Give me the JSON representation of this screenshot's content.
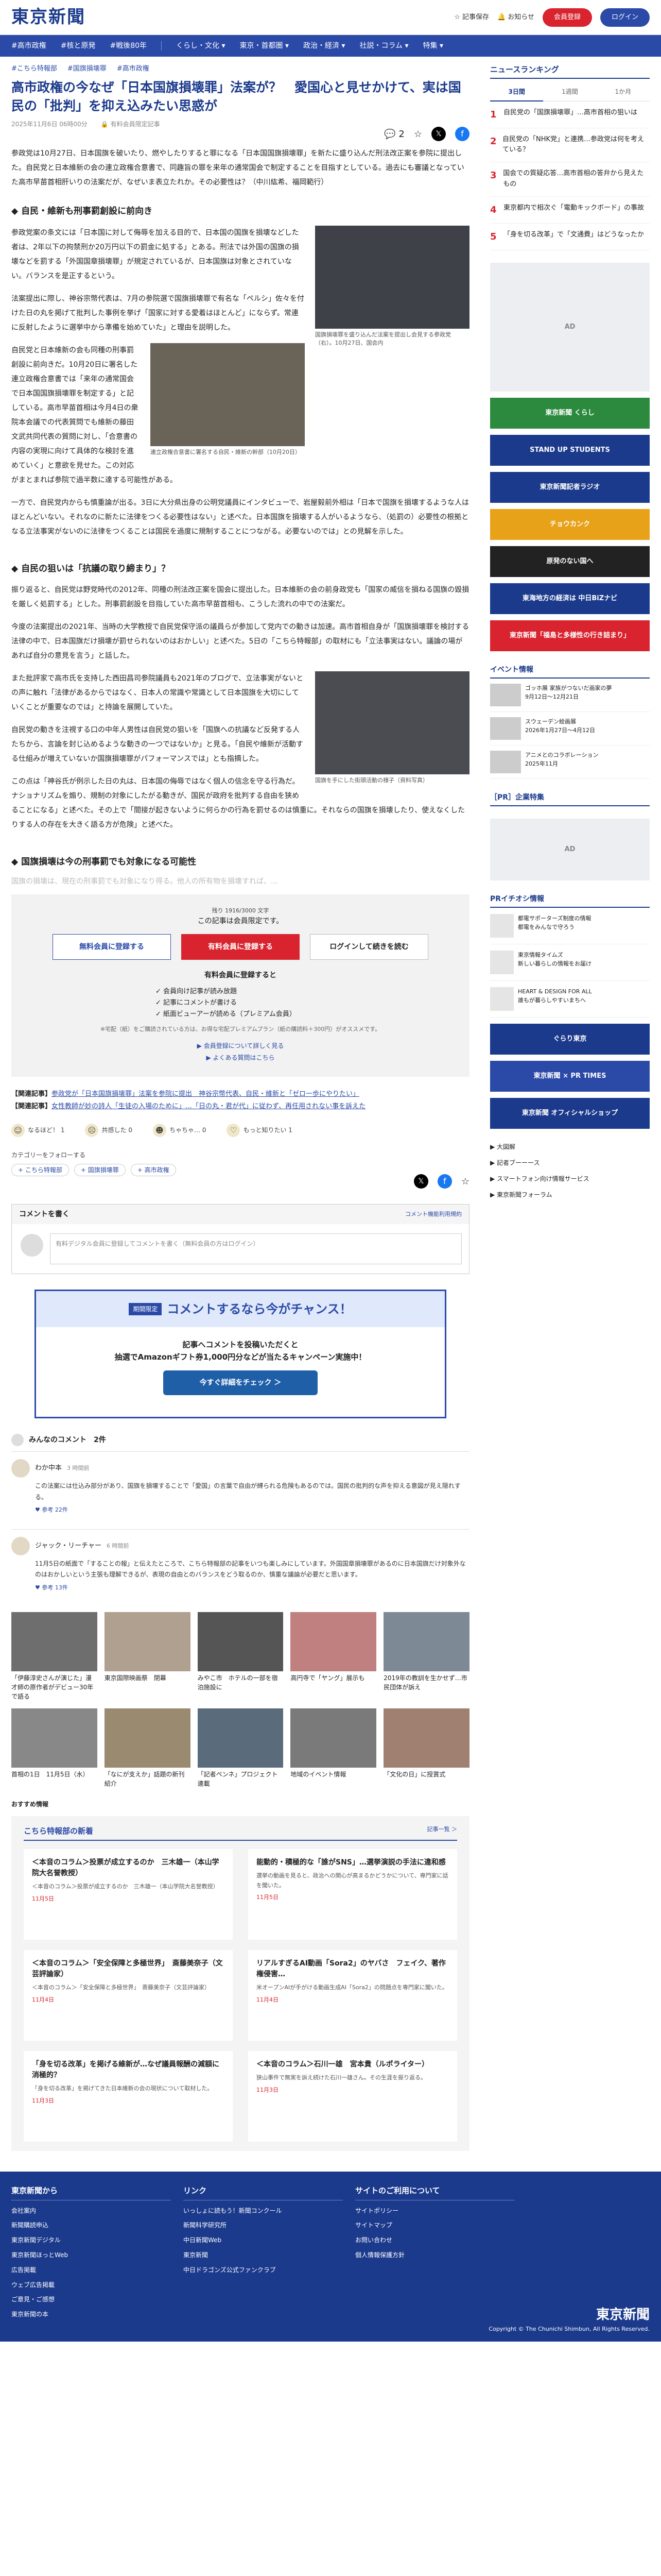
{
  "header": {
    "logo": "東京新聞",
    "bookmark": "記事保存",
    "notice": "お知らせ",
    "register": "会員登録",
    "login": "ログイン"
  },
  "nav": [
    "#高市政権",
    "#核と原発",
    "#戦後80年",
    "くらし・文化 ▾",
    "東京・首都圏 ▾",
    "政治・経済 ▾",
    "社説・コラム ▾",
    "特集 ▾"
  ],
  "article": {
    "crumbs": [
      "#こちら特報部",
      "#国旗損壊罪",
      "#高市政権"
    ],
    "title": "高市政権の今なぜ「日本国旗損壊罪」法案が？　愛国心と見せかけて、実は国民の「批判」を抑え込みたい思惑が",
    "date": "2025年11月6日 06時00分",
    "member": "有料会員限定記事",
    "comments": "2",
    "lead": "参政党は10月27日、日本国旗を破いたり、燃やしたりすると罪になる「日本国国旗損壊罪」を新たに盛り込んだ刑法改正案を参院に提出した。自民党と日本維新の会の連立政権合意書で、同趣旨の罪を来年の通常国会で制定することを目指すとしている。過去にも審議となっていた高市早苗首相肝いりの法案だが、なぜいま表立たれか。その必要性は？（中川紘希、福岡範行）",
    "h1": "自民・維新も刑事罰創設に前向き",
    "p1": "参政党案の条文には「日本国に対して侮辱を加える目的で、日本国の国旗を損壊などした者は、2年以下の拘禁刑か20万円以下の罰金に処する」とある。刑法では外国の国旗の損壊などを罰する「外国国章損壊罪」が規定されているが、日本国旗は対象とされていない。バランスを是正するという。",
    "p2": "法案提出に際し、神谷宗幣代表は、7月の参院選で国旗損壊罪で有名な「ペルシ」佐々を付けた日の丸を掲げて批判した事例を挙げ「国家に対する愛着はほとんど」にならず。常連に反射したように選挙中から準備を始めていた」と理由を説明した。",
    "p3": "自民党と日本維新の会も同種の刑事罰創設に前向きだ。10月20日に署名した連立政権合意書では「来年の通常国会で日本国国旗損壊罪を制定する」と記している。高市早苗首相は今月4日の衆院本会議での代表質問でも維新の藤田文武共同代表の質問に対し、「合意書の内容の実現に向けて具体的な検討を進めていく」と意欲を見せた。この対応がまとまれば参院で過半数に達する可能性がある。",
    "p4": "一方で、自民党内からも慎重論が出る。3日に大分県出身の公明党議員にインタビューで、岩屋毅前外相は「日本で国旗を損壊するような人はほとんどいない。それなのに新たに法律をつくる必要性はない」と述べた。日本国旗を損壊する人がいるようなら、（処罰の）必要性の根拠となる立法事実がないのに法律をつくることは国民を過度に規制することにつながる。必要ないのでは」との見解を示した。",
    "h2": "自民の狙いは「抗議の取り締まり」？",
    "p5": "振り返ると、自民党は野党時代の2012年、同種の刑法改正案を国会に提出した。日本維新の会の前身政党も「国家の威信を損ねる国旗の毀損を厳しく処罰する」とした。刑事罰創設を目指していた高市早苗首相も、こうした流れの中での法案だ。",
    "p6": "今度の法案提出の2021年、当時の大学教授で自民党保守派の議員らが参加して党内での動きは加速。高市首相自身が「国旗損壊罪を検討する法律の中で、日本国旗だけ損壊が罰せられないのはおかしい」と述べた。5日の「こちら特報部」の取材にも「立法事実はない。議論の場があれば自分の意見を言う」と話した。",
    "p7": "また批評家で高市氏を支持した西田昌司参院議員も2021年のブログで、立法事実がないとの声に触れ「法律があるからではなく、日本人の常識や常識として日本国旗を大切にしていくことが重要なのでは」と持論を展開していた。",
    "p8": "自民党の動きを注視する口の中年人男性は自民党の狙いを「国旗への抗議など反発する人たちから、言論を封じ込めるような動きの一つではないか」と見る。「自民や維新が活動する仕組みが増えていないか国旗損壊罪がパフォーマンスでは」とも指摘した。",
    "p9": "この点は「神谷氏が例示した日の丸は、日本国の侮辱ではなく個人の信念を守る行為だ。ナショナリズムを煽り、規制の対象にしたがる動きが、国民が政府を批判する自由を狭めることになる」と述べた。その上で「間接が起きないように何らかの行為を罰せるのは慎重に。それならの国旗を損壊したり、使えなくしたりする人の存在を大きく語る方が危険」と述べた。",
    "h3": "国旗損壊は今の刑事罰でも対象になる可能性",
    "blur": "国旗の損壊は、現在の刑事罰でも対象になり得る。他人の所有物を損壊すれば、...",
    "figs": [
      {
        "cap": "国旗損壊罪を盛り込んだ法案を提出し会見する参政党（右）。10月27日、国会内"
      },
      {
        "cap": "連立政権合意書に署名する自民・維新の幹部（10月20日）"
      },
      {
        "cap": "国旗を手にした街頭活動の様子（資料写真）"
      }
    ]
  },
  "paywall": {
    "limit": "残り 1916/3000 文字",
    "t1": "この記事は会員限定です。",
    "free": "無料会員に登録する",
    "paid": "有料会員に登録する",
    "cont": "ログインして続きを読む",
    "t2": "有料会員に登録すると",
    "benefits": [
      "✓ 会員向け記事が読み放題",
      "✓ 記事にコメントが書ける",
      "✓ 紙面ビューアーが読める（プレミアム会員）"
    ],
    "fine": "※宅配（紙）をご購読されている方は、お得な宅配プレミアムプラン（紙の購読料＋300円）がオススメです。",
    "link1": "▶ 会員登録について詳しく見る",
    "link2": "▶ よくある質問はこちら"
  },
  "related": [
    {
      "label": "【関連記事】",
      "text": "参政党が「日本国旗損壊罪」法案を参院に提出　神谷宗幣代表、自民・維新と「ゼロ一歩にやりたい」"
    },
    {
      "label": "【関連記事】",
      "text": "女性教師が妙の詩人「生徒の入場のために」…「日の丸・君が代」に従わず、再任用されない事を訴えた"
    }
  ],
  "reactions": [
    {
      "icon": "☺",
      "label": "なるほど！",
      "count": "1"
    },
    {
      "icon": "☹",
      "label": "共感した",
      "count": "0"
    },
    {
      "icon": "☻",
      "label": "ちゃちゃ…",
      "count": "0"
    },
    {
      "icon": "♡",
      "label": "もっと知りたい",
      "count": "1"
    }
  ],
  "follow": {
    "label": "カテゴリーをフォローする",
    "tags": [
      "+ こちら特報部",
      "+ 国旗損壊罪",
      "+ 高市政権"
    ]
  },
  "commentbox": {
    "title": "コメントを書く",
    "note": "コメント機能利用規約",
    "text": "有料デジタル会員に登録してコメントを書く（無料会員の方はログイン）"
  },
  "campaign": {
    "badge": "期間限定",
    "title": "コメントするなら今がチャンス！",
    "body": "記事へコメントを投稿いただくと\n抽選でAmazonギフト券1,000円分などが当たるキャンペーン実施中！",
    "btn": "今すぐ詳細をチェック ＞"
  },
  "comments": {
    "title": "みんなのコメント　2件",
    "items": [
      {
        "name": "わか中本",
        "time": "3 時間前",
        "body": "この法案には仕込み部分があり、国旗を損壊することで「愛国」の言葉で自由が縛られる危険もあるのでは。国民の批判的な声を抑える意図が見え隠れする。",
        "ft": "♥ 参考 22件"
      },
      {
        "name": "ジャック・リーチャー",
        "time": "6 時間前",
        "body": "11月5日の紙面で「することの報」と伝えたところで、こちら特報部の記事をいつも楽しみにしています。外国国章損壊罪があるのに日本国旗だけ対象外なのはおかしいという主張も理解できるが、表現の自由とのバランスをどう取るのか、慎重な議論が必要だと思います。",
        "ft": "♥ 参考 13件"
      }
    ]
  },
  "grid": [
    "「伊藤淳史さんが演じた」漫才師の原作者がデビュー30年で語る",
    "東京国際映画祭　閉幕",
    "みやこ市　ホテルの一部を宿泊施設に",
    "高円寺で「ヤング」展示も",
    "2019年の教訓を生かせず…市民団体が訴え",
    "首相の1日　11月5日（水）",
    "「なにが支えか」話題の新刊紹介",
    "「記者ペンネ」プロジェクト連載",
    "地域のイベント情報",
    "「文化の日」に授賞式"
  ],
  "recommend": "おすすめ情報",
  "feature": {
    "title": "こちら特報部の新着",
    "more": "記事一覧 ＞",
    "items": [
      {
        "t1": "＜本音のコラム＞投票が成立するのか　三木雄一（本山学院大名誉教授）",
        "t2": "＜本音のコラム＞投票が成立するのか　三木雄一（本山学院大名誉教授）",
        "t3": "11月5日"
      },
      {
        "t1": "能動的・積極的な「誰がSNS」…選挙演説の手法に違和感",
        "t2": "選挙の動画を見ると、政治への関心が高まるかどうかについて、専門家に話を聞いた。",
        "t3": "11月5日"
      },
      {
        "t1": "＜本音のコラム＞「安全保障と多極世界」　斎藤美奈子（文芸評論家）",
        "t2": "＜本音のコラム＞「安全保障と多極世界」　斎藤美奈子（文芸評論家）",
        "t3": "11月4日"
      },
      {
        "t1": "リアルすぎるAI動画「Sora2」のヤバさ　フェイク、著作権侵害…",
        "t2": "米オープンAIが手がける動画生成AI「Sora2」の問題点を専門家に聞いた。",
        "t3": "11月4日"
      },
      {
        "t1": "「身を切る改革」を掲げる維新が…なぜ議員報酬の減額に消極的？",
        "t2": "「身を切る改革」を掲げてきた日本維新の会の現状について取材した。",
        "t3": "11月3日"
      },
      {
        "t1": "＜本音のコラム＞石川一雄　宮本貴（ルポライター）",
        "t2": "狭山事件で無実を訴え続けた石川一雄さん。その生涯を振り返る。",
        "t3": "11月3日"
      }
    ]
  },
  "ranking": {
    "title": "ニュースランキング",
    "tabs": [
      "3日間",
      "1週間",
      "1か月"
    ],
    "items": [
      "自民党の「国旗損壊罪」…高市首相の狙いは",
      "自民党の「NHK党」と連携…参政党は何を考えている？",
      "国会での質疑応答…高市首相の答弁から見えたもの",
      "東京都内で相次ぐ「電動キックボード」の事故",
      "「身を切る改革」で「文通費」はどうなったか"
    ]
  },
  "ads": [
    "東京新聞 くらし",
    "STAND UP STUDENTS",
    "東京新聞記者ラジオ",
    "チョウカンク",
    "原発のない国へ",
    "東海地方の経済は 中日BiZナビ",
    "東京新聞「福島と多様性の行き詰まり」"
  ],
  "events": {
    "title": "イベント情報",
    "items": [
      {
        "t": "ゴッホ展 家族がつないだ画家の夢",
        "d": "9月12日〜12月21日"
      },
      {
        "t": "スウェーデン絵画展",
        "d": "2026年1月27日〜4月12日"
      },
      {
        "t": "アニメとのコラボレーション",
        "d": "2025年11月"
      }
    ]
  },
  "pr": {
    "title": "［PR］企業特集",
    "ti": "PRイチオシ情報",
    "items": [
      {
        "t": "都電サポーターズ制度の情報",
        "d": "都電をみんなで守ろう"
      },
      {
        "t": "東京情報タイムズ",
        "d": "新しい暮らしの情報をお届け"
      },
      {
        "t": "HEART & DESIGN FOR ALL",
        "d": "誰もが暮らしやすいまちへ"
      }
    ]
  },
  "ads2": [
    "ぐらり東京",
    "東京新聞 × PR TIMES",
    "東京新聞 オフィシャルショップ"
  ],
  "links": [
    "▶ 大図解",
    "▶ 記者ブーーース",
    "▶ スマートフォン向け情報サービス",
    "▶ 東京新聞フォーラム"
  ],
  "footer": {
    "cols": [
      {
        "h": "東京新聞から",
        "items": [
          "会社案内",
          "新聞購読申込",
          "東京新聞デジタル",
          "東京新聞ほっとWeb",
          "広告掲載",
          "ウェブ広告掲載",
          "ご意見・ご感想",
          "東京新聞の本"
        ]
      },
      {
        "h": "リンク",
        "items": [
          "いっしょに読もう！新聞コンクール",
          "新聞科学研究所",
          "中日新聞Web",
          "東京新聞",
          "中日ドラゴンズ公式ファンクラブ"
        ]
      },
      {
        "h": "サイトのご利用について",
        "items": [
          "サイトポリシー",
          "サイトマップ",
          "お問い合わせ",
          "個人情報保護方針"
        ]
      }
    ],
    "logo": "東京新聞",
    "copy": "Copyright © The Chunichi Shimbun, All Rights Reserved."
  }
}
